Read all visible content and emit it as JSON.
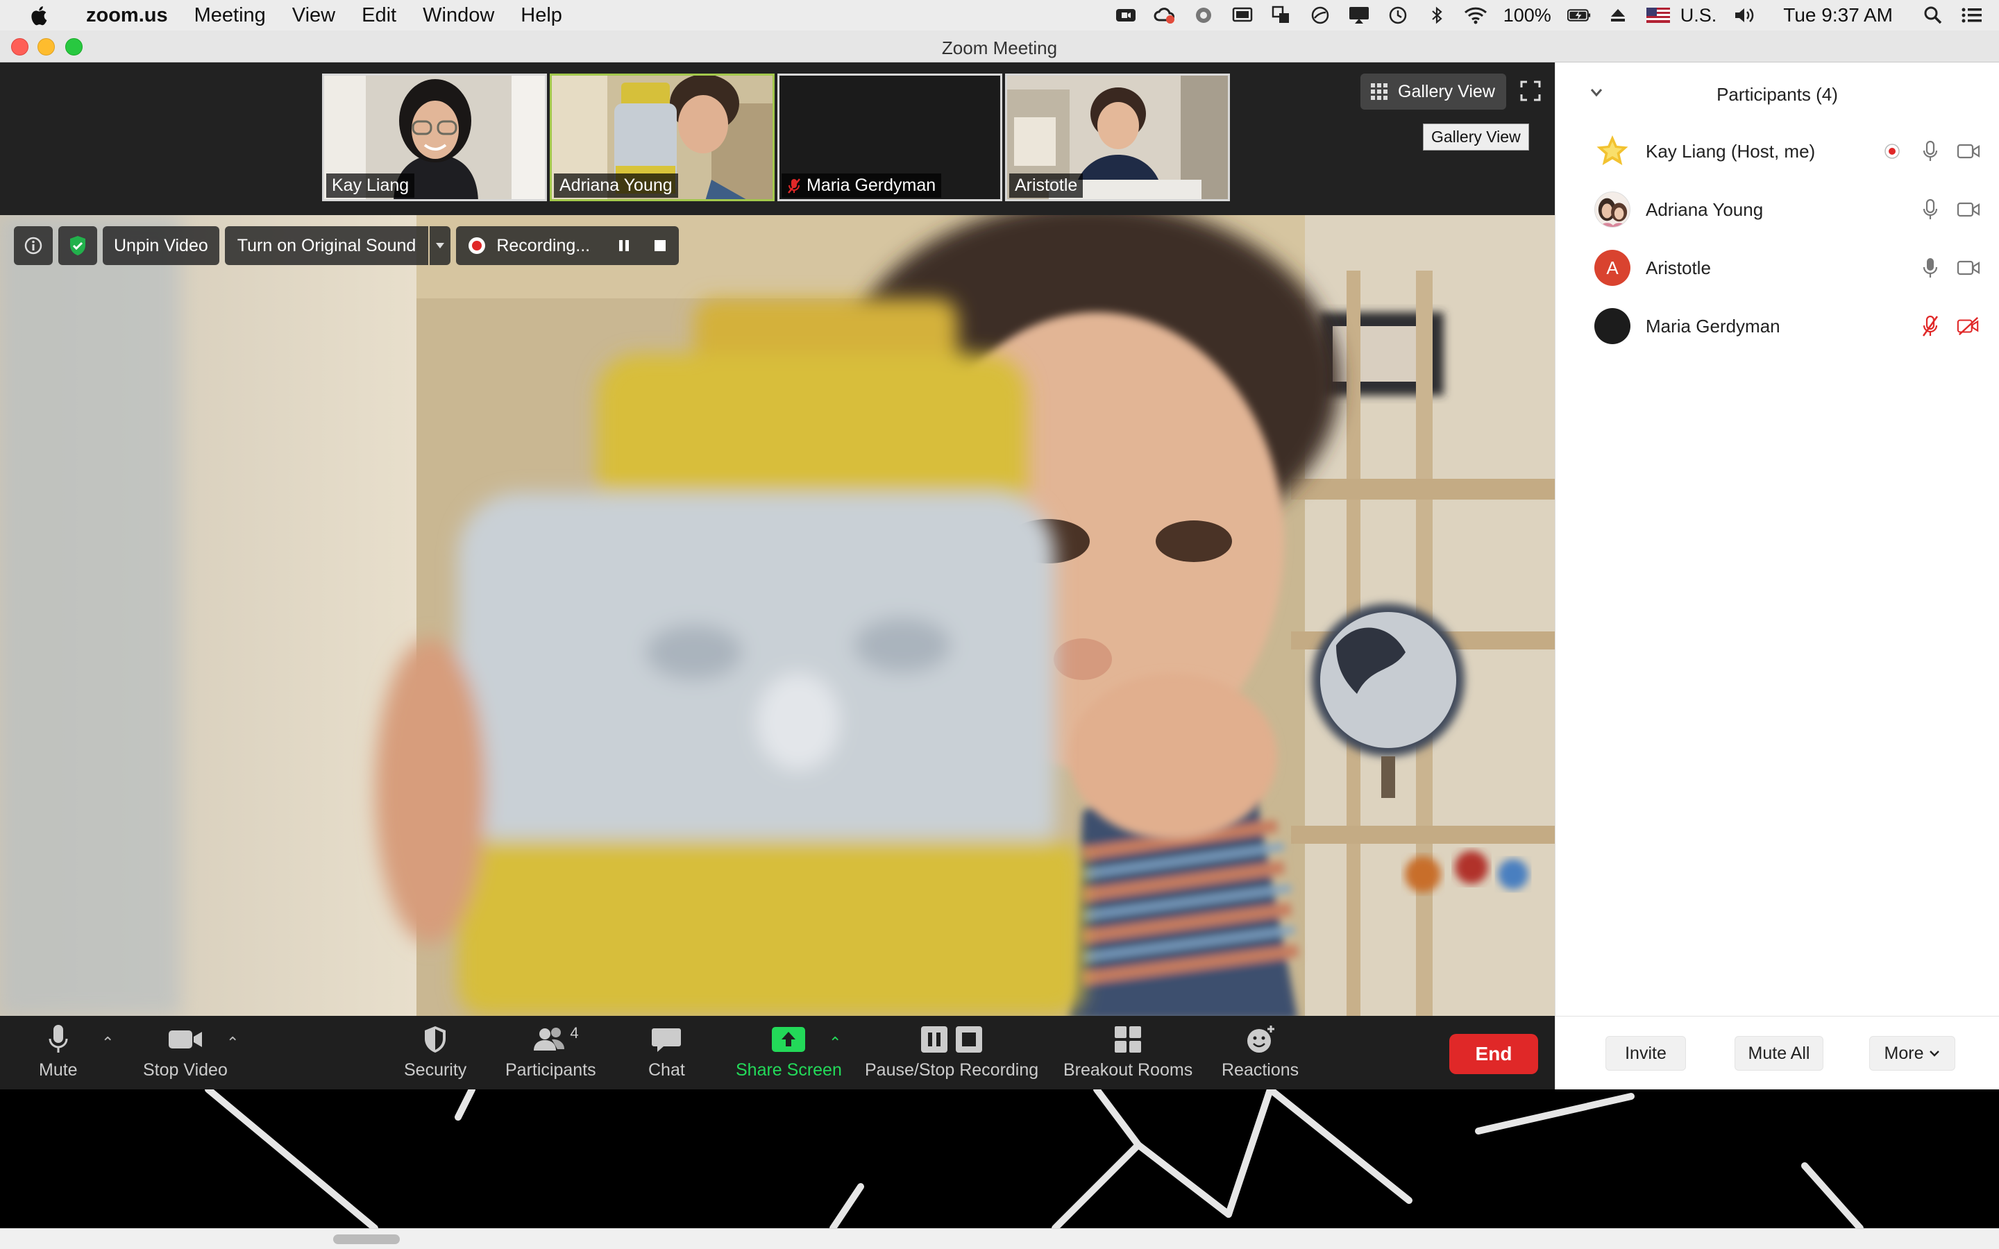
{
  "menubar": {
    "app_name": "zoom.us",
    "items": [
      "Meeting",
      "View",
      "Edit",
      "Window",
      "Help"
    ],
    "battery": "100%",
    "input_source": "U.S.",
    "clock": "Tue 9:37 AM"
  },
  "window": {
    "title": "Zoom Meeting"
  },
  "thumbnails": [
    {
      "name": "Kay Liang",
      "muted": false
    },
    {
      "name": "Adriana Young",
      "muted": false,
      "active": true
    },
    {
      "name": "Maria Gerdyman",
      "muted": true
    },
    {
      "name": "Aristotle",
      "muted": false
    }
  ],
  "view": {
    "gallery_label": "Gallery View",
    "gallery_tooltip": "Gallery View"
  },
  "video_toolbar": {
    "unpin_label": "Unpin Video",
    "original_sound_label": "Turn on Original Sound",
    "recording_label": "Recording..."
  },
  "controls": {
    "mute": "Mute",
    "stop_video": "Stop Video",
    "security": "Security",
    "participants": "Participants",
    "participants_count": "4",
    "chat": "Chat",
    "share_screen": "Share Screen",
    "recording": "Pause/Stop Recording",
    "breakout": "Breakout Rooms",
    "reactions": "Reactions",
    "end": "End"
  },
  "panel": {
    "title": "Participants (4)",
    "participants": [
      {
        "name": "Kay Liang (Host, me)",
        "avatar": "star",
        "recording": true,
        "mic_muted": false,
        "video_off": false
      },
      {
        "name": "Adriana Young",
        "avatar": "photo",
        "recording": false,
        "mic_muted": false,
        "video_off": false
      },
      {
        "name": "Aristotle",
        "avatar": "initial",
        "initial": "A",
        "recording": false,
        "mic_muted": false,
        "video_off": false
      },
      {
        "name": "Maria Gerdyman",
        "avatar": "dark",
        "recording": false,
        "mic_muted": true,
        "video_off": true
      }
    ],
    "footer": {
      "invite": "Invite",
      "mute_all": "Mute All",
      "more": "More"
    }
  },
  "colors": {
    "end_button": "#e02828",
    "share_screen": "#23d959",
    "active_thumb_border": "#a3c84c",
    "security_shield": "#22b14c",
    "muted_red": "#e02828",
    "avatar_aristotle": "#d9432f"
  }
}
